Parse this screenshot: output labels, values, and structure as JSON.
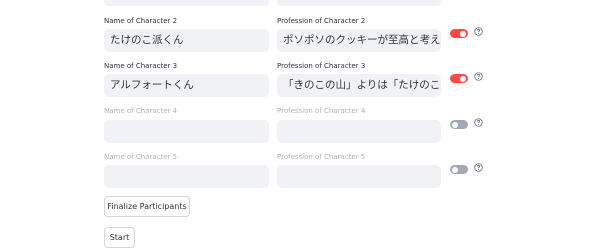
{
  "characters": [
    {
      "name_label": "Name of Character 2",
      "name_value": "たけのこ派くん",
      "profession_label": "Profession of Character 2",
      "profession_value": "ポソポソのクッキーが至高と考えている",
      "enabled": true
    },
    {
      "name_label": "Name of Character 3",
      "name_value": "アルフォートくん",
      "profession_label": "Profession of Character 3",
      "profession_value": "「きのこの山」よりは「たけのこの里」",
      "enabled": true
    },
    {
      "name_label": "Name of Character 4",
      "name_value": "",
      "profession_label": "Profession of Character 4",
      "profession_value": "",
      "enabled": false
    },
    {
      "name_label": "Name of Character 5",
      "name_value": "",
      "profession_label": "Profession of Character 5",
      "profession_value": "",
      "enabled": false
    }
  ],
  "buttons": {
    "finalize": "Finalize Participants",
    "start": "Start"
  },
  "icons": {
    "help": "help-circle-icon"
  },
  "colors": {
    "toggle_on": "#ff4b4b",
    "toggle_off": "#a3a8b4",
    "field_bg": "#f0f2f6"
  }
}
